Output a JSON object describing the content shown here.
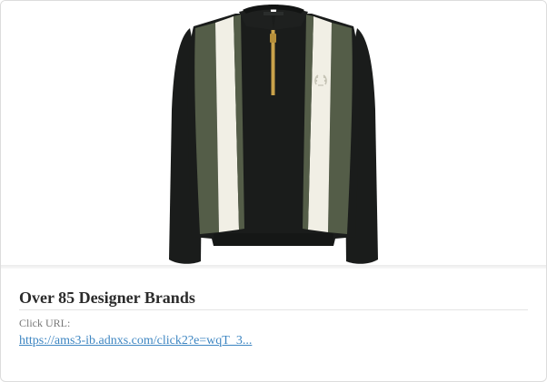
{
  "ad": {
    "title": "Over 85 Designer Brands",
    "click_label": "Click URL:",
    "click_url": "https://ams3-ib.adnxs.com/click2?e=wqT_3..."
  },
  "product_image": {
    "subject": "long-sleeve-knit-polo-shirt",
    "icon": "laurel-wreath-logo-icon",
    "colors": {
      "body": "#1a1c1b",
      "stripe_green": "#545d48",
      "stripe_cream": "#f1efe5",
      "zip": "#c9a24a",
      "logo": "#c6c4b6"
    }
  }
}
